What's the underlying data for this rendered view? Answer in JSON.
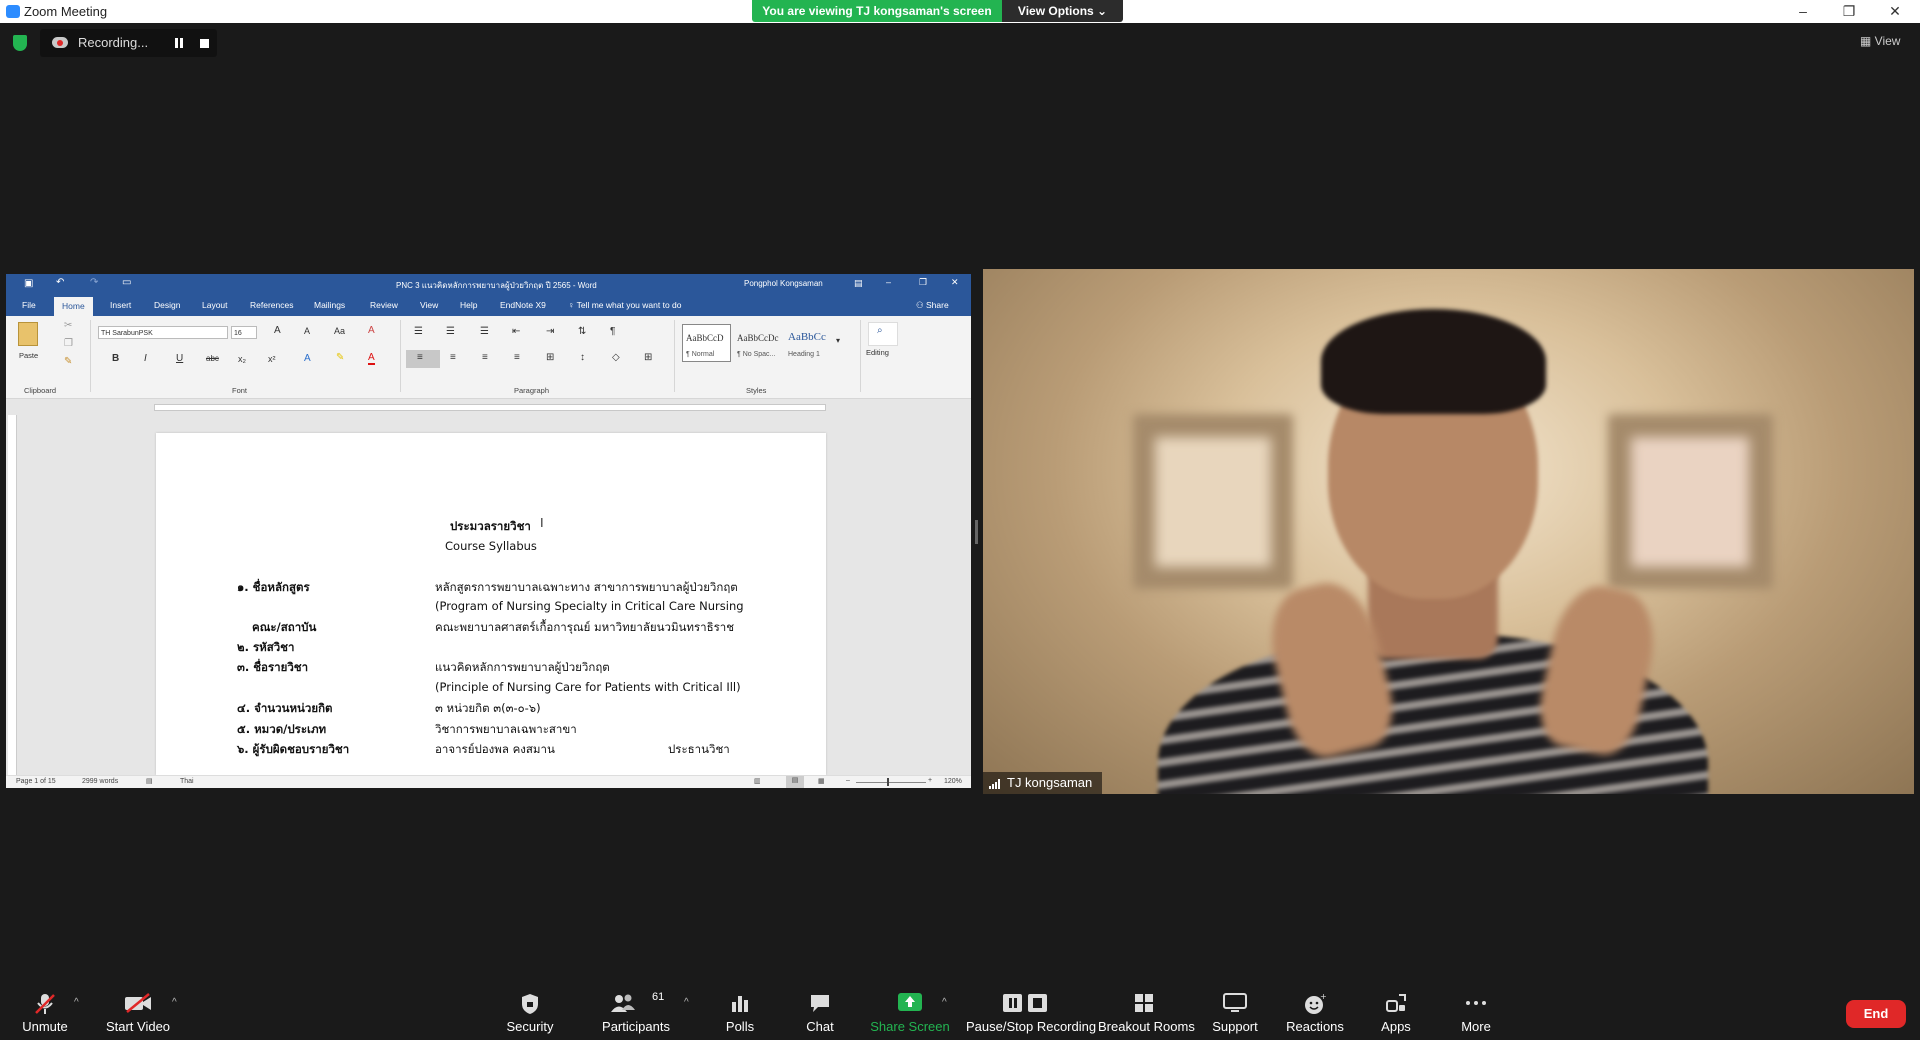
{
  "window": {
    "title": "Zoom Meeting",
    "minimize": "–",
    "restore": "❐",
    "close": "✕"
  },
  "banner": {
    "viewing": "You are viewing TJ kongsaman's screen",
    "view_options": "View Options ⌄"
  },
  "recording": {
    "label": "Recording..."
  },
  "top_right": {
    "view_label": "View"
  },
  "word": {
    "title": "PNC 3 แนวคิดหลักการพยาบาลผู้ป่วยวิกฤต ปี 2565 - Word",
    "user": "Pongphol Kongsaman",
    "tabs": [
      "File",
      "Home",
      "Insert",
      "Design",
      "Layout",
      "References",
      "Mailings",
      "Review",
      "View",
      "Help",
      "EndNote X9"
    ],
    "tell_me": "Tell me what you want to do",
    "share": "Share",
    "ribbon": {
      "paste": "Paste",
      "font_name": "TH SarabunPSK",
      "font_size": "16",
      "groups": [
        "Clipboard",
        "Font",
        "Paragraph",
        "Styles"
      ],
      "styles": [
        {
          "preview": "AaBbCcD",
          "name": "¶ Normal"
        },
        {
          "preview": "AaBbCcDc",
          "name": "¶ No Spac..."
        },
        {
          "preview": "AaBbCc",
          "name": "Heading 1"
        }
      ],
      "editing": "Editing"
    },
    "document": {
      "heading_th": "ประมวลรายวิชา",
      "heading_en": "Course Syllabus",
      "rows": [
        {
          "label": "๑. ชื่อหลักสูตร",
          "value": "หลักสูตรการพยาบาลเฉพาะทาง สาขาการพยาบาลผู้ป่วยวิกฤต"
        },
        {
          "label": "",
          "value": "(Program of Nursing Specialty in Critical Care Nursing"
        },
        {
          "label": "คณะ/สถาบัน",
          "value": "คณะพยาบาลศาสตร์เกื้อการุณย์ มหาวิทยาลัยนวมินทราธิราช"
        },
        {
          "label": "๒. รหัสวิชา",
          "value": ""
        },
        {
          "label": "๓. ชื่อรายวิชา",
          "value": "แนวคิดหลักการพยาบาลผู้ป่วยวิกฤต"
        },
        {
          "label": "",
          "value": "(Principle of Nursing Care for Patients with Critical Ill)"
        },
        {
          "label": "๔. จำนวนหน่วยกิต",
          "value": "๓ หน่วยกิต ๓(๓-๐-๖)"
        },
        {
          "label": "๕. หมวด/ประเภท",
          "value": "วิชาการพยาบาลเฉพาะสาขา"
        },
        {
          "label": "๖. ผู้รับผิดชอบรายวิชา",
          "value": "อาจารย์ปองพล  คงสมาน",
          "extra": "ประธานวิชา"
        }
      ]
    },
    "status": {
      "page": "Page 1 of 15",
      "words": "2999 words",
      "language": "Thai",
      "zoom": "120%"
    }
  },
  "video": {
    "participant_name": "TJ kongsaman"
  },
  "toolbar": {
    "unmute": "Unmute",
    "start_video": "Start Video",
    "security": "Security",
    "participants": "Participants",
    "participants_count": "61",
    "polls": "Polls",
    "chat": "Chat",
    "share_screen": "Share Screen",
    "pause_stop_recording": "Pause/Stop Recording",
    "breakout_rooms": "Breakout Rooms",
    "support": "Support",
    "reactions": "Reactions",
    "apps": "Apps",
    "more": "More",
    "end": "End"
  },
  "colors": {
    "zoom_blue": "#2d8cff",
    "green": "#23b451",
    "word_blue": "#2b579a",
    "end_red": "#e02828"
  }
}
